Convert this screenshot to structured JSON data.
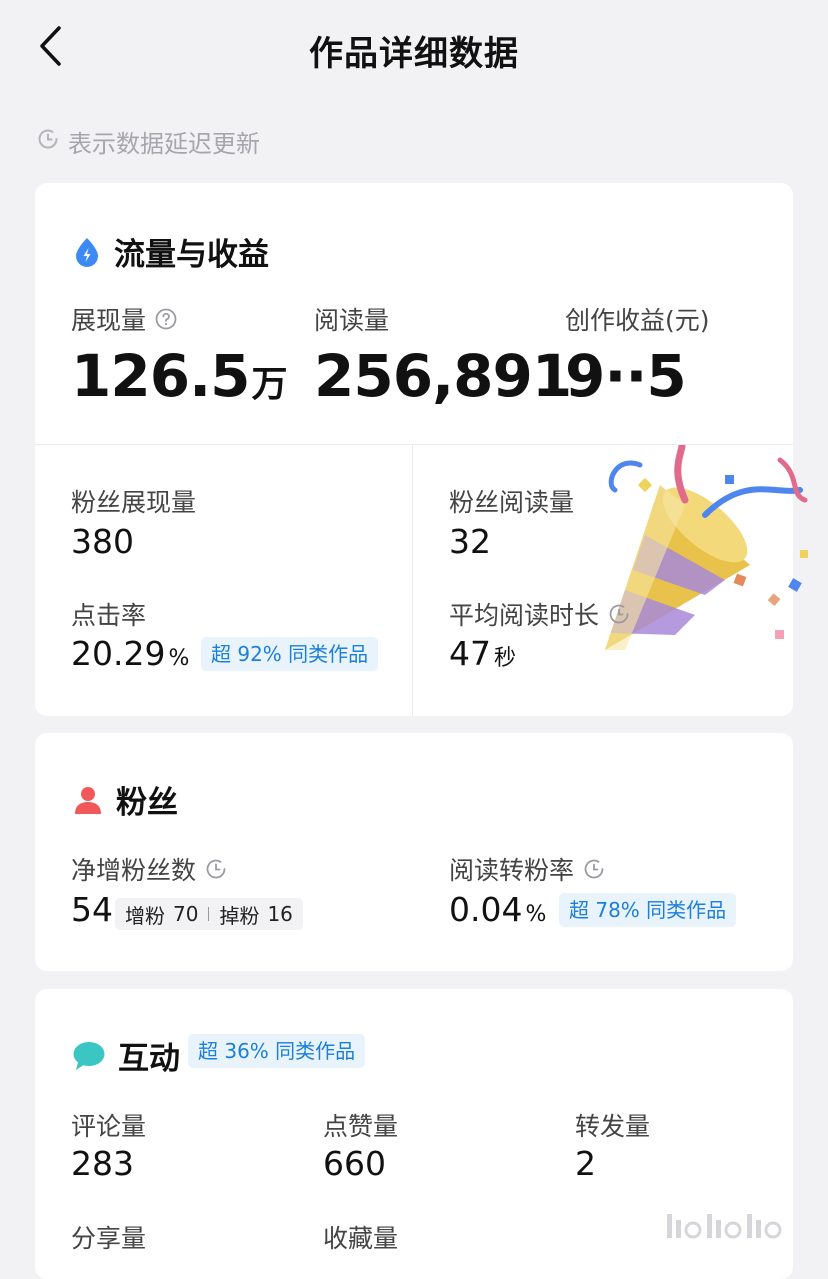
{
  "header": {
    "title": "作品详细数据",
    "back_icon": "chevron-left-icon"
  },
  "notice": {
    "text": "表示数据延迟更新",
    "icon": "clock-icon"
  },
  "traffic": {
    "title": "流量与收益",
    "icon": "lightning-drop-icon",
    "accent": "#3d8af7",
    "impressions": {
      "label": "展现量",
      "value": "126.5",
      "unit": "万"
    },
    "reads": {
      "label": "阅读量",
      "value": "256,891"
    },
    "earnings": {
      "label": "创作收益(元)",
      "value": "9··5"
    },
    "fan_impressions": {
      "label": "粉丝展现量",
      "value": "380"
    },
    "fan_reads": {
      "label": "粉丝阅读量",
      "value": "32"
    },
    "ctr": {
      "label": "点击率",
      "value": "20.29",
      "unit": "%",
      "badge": "超 92% 同类作品"
    },
    "avg_read_time": {
      "label": "平均阅读时长",
      "value": "47",
      "unit": "秒"
    }
  },
  "fans": {
    "title": "粉丝",
    "icon": "person-icon",
    "accent": "#f0585a",
    "net_gain": {
      "label": "净增粉丝数",
      "value": "54",
      "gain_label": "增粉",
      "gain_value": "70",
      "loss_label": "掉粉",
      "loss_value": "16"
    },
    "conversion": {
      "label": "阅读转粉率",
      "value": "0.04",
      "unit": "%",
      "badge": "超 78% 同类作品"
    }
  },
  "interaction": {
    "title": "互动",
    "icon": "chat-bubble-icon",
    "accent": "#3ac6c2",
    "badge": "超 36% 同类作品",
    "comments": {
      "label": "评论量",
      "value": "283"
    },
    "likes": {
      "label": "点赞量",
      "value": "660"
    },
    "reposts": {
      "label": "转发量",
      "value": "2"
    },
    "shares": {
      "label": "分享量"
    },
    "favorites": {
      "label": "收藏量"
    }
  },
  "colors": {
    "badge_bg": "#e8f3fc",
    "badge_text": "#1c7fd8",
    "page_bg": "#f2f2f4"
  }
}
